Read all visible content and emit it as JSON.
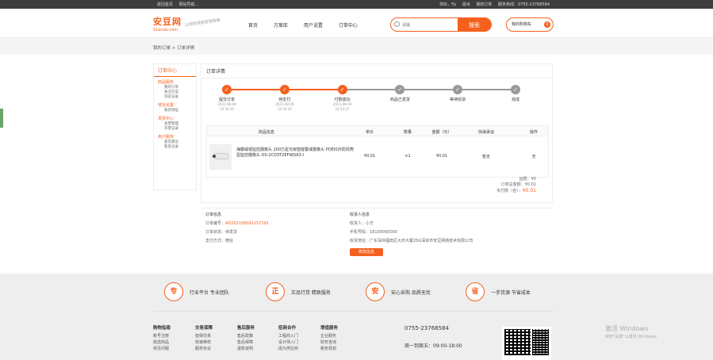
{
  "topbar": {
    "left": [
      "返回首页",
      "网站导航..."
    ],
    "right": [
      "你好，Fp",
      "退出",
      "我的订单",
      "服务热线：0755-23768584"
    ]
  },
  "logo": {
    "main": "安豆网",
    "sub": "51ando.com",
    "slogan": "让安防项目变得简单"
  },
  "nav": [
    "首页",
    "方案库",
    "用户设置",
    "订单中心"
  ],
  "search": {
    "placeholder": "请输",
    "button": "搜索"
  },
  "cart": {
    "label": "我的购物车",
    "count": "0"
  },
  "breadcrumb": "我的订单 > 订单详情",
  "sidebar": {
    "title": "订单中心",
    "groups": [
      {
        "title": "商品服务",
        "items": [
          "我的订单",
          "关注方案",
          "浏览记录"
        ]
      },
      {
        "title": "地址设置",
        "items": [
          "收货地址"
        ]
      },
      {
        "title": "发票中心",
        "items": [
          "发票管理",
          "开票记录"
        ]
      },
      {
        "title": "用户服务",
        "items": [
          "意见建议",
          "售后记录"
        ]
      }
    ]
  },
  "panel_title": "订单详情",
  "steps": [
    {
      "label": "提交订单",
      "date": "2021-08-09",
      "time": "14:34:16",
      "done": true
    },
    {
      "label": "待支付",
      "date": "2021-08-09",
      "time": "14:34:16",
      "done": true
    },
    {
      "label": "付款成功",
      "date": "2021-08-09",
      "time": "14:33:37",
      "done": true
    },
    {
      "label": "商品已发货",
      "date": "",
      "time": "",
      "done": false
    },
    {
      "label": "等待收货",
      "date": "",
      "time": "",
      "done": false
    },
    {
      "label": "完成",
      "date": "",
      "time": "",
      "done": false
    }
  ],
  "table": {
    "headers": [
      "商品信息",
      "单价",
      "数量",
      "金额（元）",
      "快递承运",
      "操作"
    ],
    "row": {
      "name": "海康威视监控摄像头 200万星光级智能警戒摄像头 POE红外防风筒型监控摄像头 DS-2CD3T26FWDA3-I",
      "price": "¥0.01",
      "qty": "×1",
      "amount": "¥0.01",
      "carrier": "暂无",
      "action": "无"
    }
  },
  "summary": {
    "shipping": "运费：¥0",
    "total_label": "订单总金额：",
    "total": "¥0.01",
    "paid_label": "实付款（含）：",
    "paid": "¥0.01"
  },
  "order_info": {
    "title": "订单信息",
    "no_label": "订单编号：",
    "no": "AD202108091157191",
    "status": "订单状态：待发货",
    "pay": "支付方式：微信"
  },
  "receiver": {
    "title": "收货人信息",
    "name": "收货人：小方",
    "phone": "手机号码：18100000000",
    "address": "收货地址：广东深圳福田区大庆大厦25G深圳市安豆网络技术有限公司",
    "edit": "修改信息"
  },
  "footer_badges": [
    {
      "char": "专",
      "text": "行业平台 专业团队"
    },
    {
      "char": "正",
      "text": "正品行货 精致服务"
    },
    {
      "char": "安",
      "text": "安心采购 品质无忧"
    },
    {
      "char": "省",
      "text": "一手货源 节省成本"
    }
  ],
  "footer_cols": [
    {
      "title": "购物指南",
      "items": [
        "账号注册",
        "挑选商品",
        "常见问题"
      ]
    },
    {
      "title": "交易保障",
      "items": [
        "担保交易",
        "快速维权",
        "服务协议"
      ]
    },
    {
      "title": "售后服务",
      "items": [
        "售后政策",
        "售后保障",
        "退款说明"
      ]
    },
    {
      "title": "招商合作",
      "items": [
        "工程商入门",
        "设计师入门",
        "成为供应商"
      ]
    },
    {
      "title": "增值服务",
      "items": [
        "企业服务",
        "财务咨询",
        "税务规划"
      ]
    }
  ],
  "footer_phone": "0755-23768584",
  "footer_hours": "周一到周五：09:00-18:00",
  "watermark": {
    "line1": "激活 Windows",
    "line2": "转到\"设置\"以激活 Windows。"
  },
  "colors": {
    "accent": "#f4611e",
    "pending": "#999999"
  }
}
